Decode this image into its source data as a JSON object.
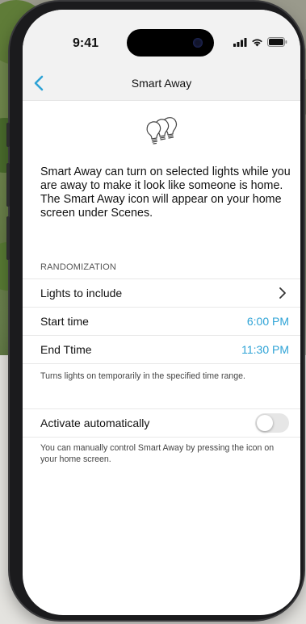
{
  "status_bar": {
    "time": "9:41",
    "icons": [
      "signal-icon",
      "wifi-icon",
      "battery-icon"
    ]
  },
  "nav": {
    "title": "Smart Away",
    "back_icon": "chevron-left-icon"
  },
  "header_icon": "light-bulbs-icon",
  "description": {
    "line1": "Smart Away can turn on selected lights while you are away to make it look like someone is home.",
    "line2": "The Smart Away icon will appear on your home screen under Scenes."
  },
  "randomization": {
    "header": "RANDOMIZATION",
    "rows": [
      {
        "label": "Lights to include",
        "value": ""
      },
      {
        "label": "Start time",
        "value": "6:00 PM"
      },
      {
        "label": "End Ttime",
        "value": "11:30 PM"
      }
    ],
    "helper": "Turns lights on temporarily in the specified time range."
  },
  "activate": {
    "label": "Activate automatically",
    "enabled": false,
    "helper": "You can manually control Smart Away by pressing the icon on your home screen."
  },
  "colors": {
    "accent": "#2ea3d6",
    "nav_background": "#f2f2f2",
    "phone_frame": "#1b1b1d"
  }
}
